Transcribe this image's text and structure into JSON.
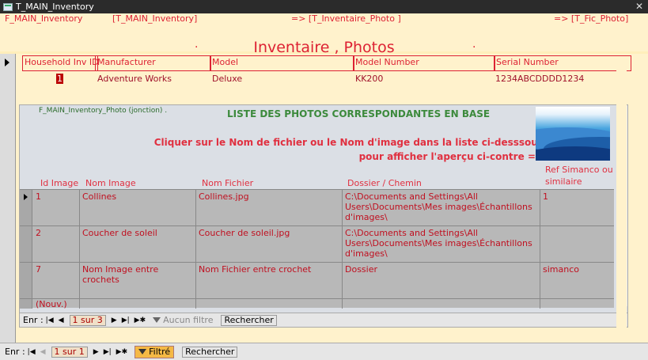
{
  "window": {
    "title": "T_MAIN_Inventory",
    "close_glyph": "✕"
  },
  "header": {
    "links": [
      "F_MAIN_Inventory",
      "[T_MAIN_Inventory]",
      "=> [T_Inventaire_Photo ]",
      "=> [T_Fic_Photo]"
    ],
    "title": "Inventaire  , Photos",
    "dots": [
      ".",
      "."
    ]
  },
  "main_form": {
    "columns": [
      "Household Inv ID",
      "Manufacturer",
      "Model",
      "Model Number",
      "Serial Number"
    ],
    "record": {
      "id": "1",
      "manufacturer": "Adventure Works",
      "model": "Deluxe",
      "model_number": "KK200",
      "serial_number": "1234ABCDDDD1234"
    }
  },
  "subform": {
    "label": "F_MAIN_Inventory_Photo (jonction) .",
    "title": "LISTE DES PHOTOS CORRESPONDANTES EN BASE",
    "instructions": [
      "Cliquer sur le Nom de fichier ou le Nom d'image dans la liste ci-desssous",
      "pour afficher l'aperçu ci-contre =>"
    ],
    "columns": [
      "Id Image",
      "Nom Image",
      "Nom Fichier",
      "Dossier / Chemin",
      "Ref Simanco ou similaire"
    ],
    "rows": [
      {
        "id": "1",
        "nom_image": "Collines",
        "nom_fichier": "Collines.jpg",
        "dossier": "C:\\Documents and Settings\\All Users\\Documents\\Mes images\\Échantillons d'images\\",
        "ref": "1"
      },
      {
        "id": "2",
        "nom_image": "Coucher de soleil",
        "nom_fichier": "Coucher de soleil.jpg",
        "dossier": "C:\\Documents and Settings\\All Users\\Documents\\Mes images\\Échantillons d'images\\",
        "ref": ""
      },
      {
        "id": "7",
        "nom_image": "Nom Image entre crochets",
        "nom_fichier": "Nom Fichier entre crochet",
        "dossier": "Dossier",
        "ref": "simanco"
      },
      {
        "id": "(Nouv.)",
        "nom_image": "",
        "nom_fichier": "",
        "dossier": "",
        "ref": ""
      }
    ],
    "nav": {
      "label": "Enr :",
      "record": "1 sur 3",
      "filter": "Aucun filtre",
      "search": "Rechercher"
    }
  },
  "main_nav": {
    "label": "Enr :",
    "record": "1 sur 1",
    "filter": "Filtré",
    "search": "Rechercher"
  }
}
